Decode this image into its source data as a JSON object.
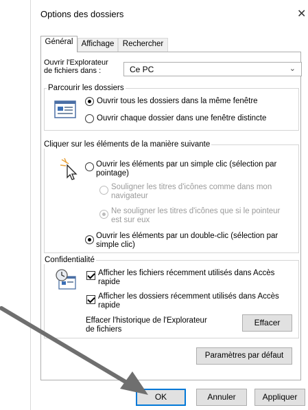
{
  "window": {
    "title": "Options des dossiers",
    "close_glyph": "✕"
  },
  "tabs": [
    {
      "label": "Général",
      "active": true
    },
    {
      "label": "Affichage",
      "active": false
    },
    {
      "label": "Rechercher",
      "active": false
    }
  ],
  "open_explorer": {
    "label_line1": "Ouvrir l'Explorateur",
    "label_line2": "de fichiers dans :",
    "selected": "Ce PC",
    "chevron": "⌄"
  },
  "browse_folders": {
    "group_label": "Parcourir les dossiers",
    "icon": "folder-window-icon",
    "options": [
      {
        "label": "Ouvrir tous les dossiers dans la même fenêtre",
        "checked": true
      },
      {
        "label": "Ouvrir chaque dossier dans une fenêtre distincte",
        "checked": false
      }
    ]
  },
  "click_items": {
    "group_label": "Cliquer sur les éléments de la manière suivante",
    "icon": "pointer-click-icon",
    "single_click": {
      "line1": "Ouvrir les éléments par un simple clic (sélection par",
      "line2": "pointage)",
      "checked": false
    },
    "underline_browser": {
      "line1": "Souligner les titres d'icônes comme dans mon",
      "line2": "navigateur",
      "checked": false,
      "disabled": true
    },
    "underline_hover": {
      "line1": "Ne souligner les titres d'icônes que si le pointeur",
      "line2": "est sur eux",
      "checked": true,
      "disabled": true
    },
    "double_click": {
      "line1": "Ouvrir les éléments par un double-clic (sélection par",
      "line2": "simple clic)",
      "checked": true
    }
  },
  "privacy": {
    "group_label": "Confidentialité",
    "icon": "clock-document-icon",
    "show_recent_files": {
      "line1": "Afficher les fichiers récemment utilisés dans Accès",
      "line2": "rapide",
      "checked": true
    },
    "show_frequent_folders": {
      "line1": "Afficher les dossiers récemment utilisés dans Accès",
      "line2": "rapide",
      "checked": true
    },
    "clear_history": {
      "line1": "Effacer l'historique de l'Explorateur",
      "line2": "de fichiers",
      "button": "Effacer"
    }
  },
  "restore_defaults_button": "Paramètres par défaut",
  "footer": {
    "ok": "OK",
    "cancel": "Annuler",
    "apply": "Appliquer"
  },
  "colors": {
    "accent": "#0078d7",
    "arrow": "#6f6f6f",
    "button_bg": "#e1e1e1"
  }
}
